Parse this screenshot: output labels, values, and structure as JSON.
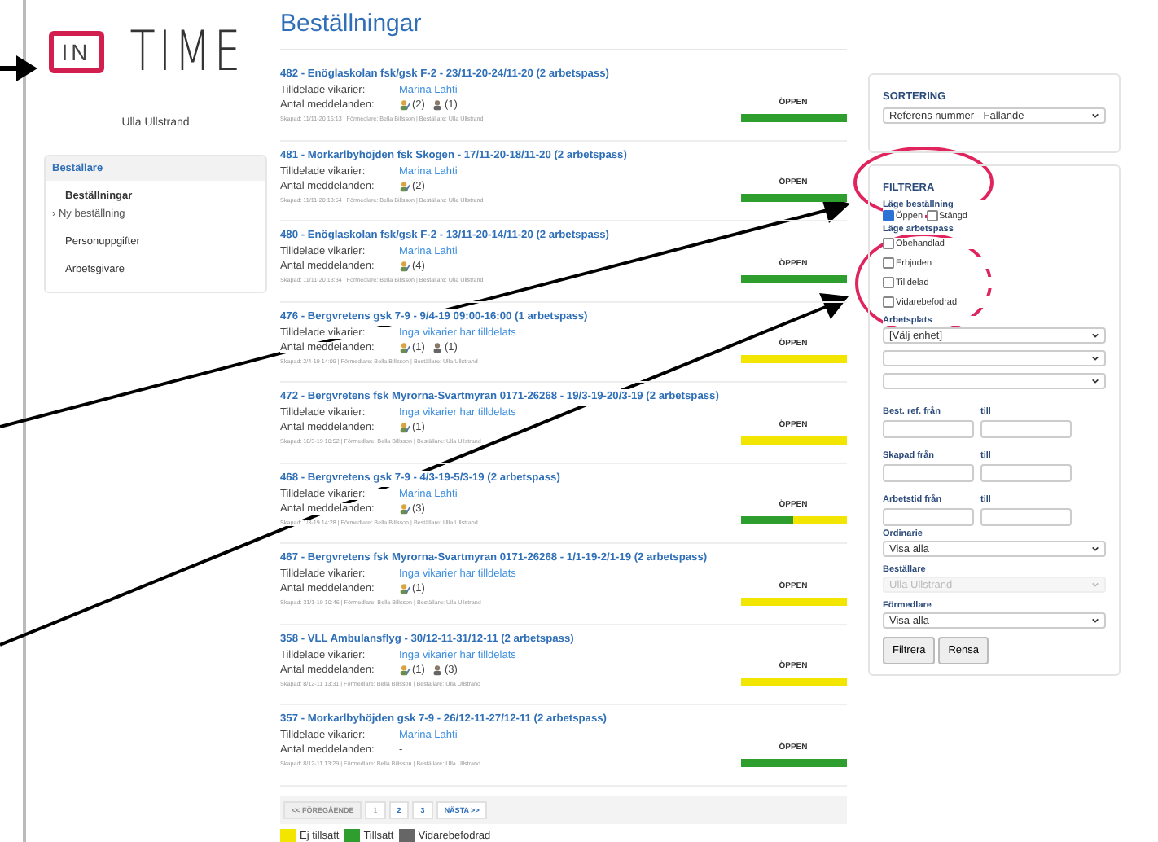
{
  "sidebar": {
    "logo": {
      "boxed": "IN",
      "word": "TIME"
    },
    "user": "Ulla Ullstrand",
    "menu_header": "Beställare",
    "items": [
      {
        "label": "Beställningar",
        "kind": "main",
        "selected": true
      },
      {
        "label": "› Ny beställning",
        "kind": "sub",
        "selected": false
      },
      {
        "label": "Personuppgifter",
        "kind": "main",
        "selected": false
      },
      {
        "label": "Arbetsgivare",
        "kind": "main",
        "selected": false
      }
    ]
  },
  "main": {
    "title": "Beställningar",
    "orders": [
      {
        "title": "482 - Enöglaskolan fsk/gsk F-2 - 23/11-20-24/11-20 (2 arbetspass)",
        "assigned_label": "Tilldelade vikarier:",
        "assigned": "Marina Lahti",
        "messages_label": "Antal meddelanden:",
        "messages": [
          {
            "kind": "message",
            "count": "(2)"
          },
          {
            "kind": "person",
            "count": "(1)"
          }
        ],
        "meta": "Skapad: 11/11-20 16:13 | Förmedlare: Bella Billsson | Beställare: Ulla Ullstrand",
        "status": "ÖPPEN",
        "level": 1
      },
      {
        "title": "481 - Morkarlbyhöjden fsk Skogen - 17/11-20-18/11-20 (2 arbetspass)",
        "assigned_label": "Tilldelade vikarier:",
        "assigned": "Marina Lahti",
        "messages_label": "Antal meddelanden:",
        "messages": [
          {
            "kind": "message",
            "count": "(2)"
          }
        ],
        "meta": "Skapad: 11/11-20 13:54 | Förmedlare: Bella Billsson | Beställare: Ulla Ullstrand",
        "status": "ÖPPEN",
        "level": 1
      },
      {
        "title": "480 - Enöglaskolan fsk/gsk F-2 - 13/11-20-14/11-20 (2 arbetspass)",
        "assigned_label": "Tilldelade vikarier:",
        "assigned": "Marina Lahti",
        "messages_label": "Antal meddelanden:",
        "messages": [
          {
            "kind": "message",
            "count": "(4)"
          }
        ],
        "meta": "Skapad: 11/11-20 13:34 | Förmedlare: Bella Billsson | Beställare: Ulla Ullstrand",
        "status": "ÖPPEN",
        "level": 1
      },
      {
        "title": "476 - Bergvretens gsk 7-9 - 9/4-19 09:00-16:00 (1 arbetspass)",
        "assigned_label": "Tilldelade vikarier:",
        "assigned": "Inga vikarier har tilldelats",
        "messages_label": "Antal meddelanden:",
        "messages": [
          {
            "kind": "message",
            "count": "(1)"
          },
          {
            "kind": "person",
            "count": "(1)"
          }
        ],
        "meta": "Skapad: 2/4-19 14:09 | Förmedlare: Bella Billsson | Beställare: Ulla Ullstrand",
        "status": "ÖPPEN",
        "level": 0
      },
      {
        "title": "472 - Bergvretens fsk Myrorna-Svartmyran 0171-26268 - 19/3-19-20/3-19 (2 arbetspass)",
        "assigned_label": "Tilldelade vikarier:",
        "assigned": "Inga vikarier har tilldelats",
        "messages_label": "Antal meddelanden:",
        "messages": [
          {
            "kind": "message",
            "count": "(1)"
          }
        ],
        "meta": "Skapad: 18/3-19 10:52 | Förmedlare: Bella Billsson | Beställare: Ulla Ullstrand",
        "status": "ÖPPEN",
        "level": 0
      },
      {
        "title": "468 - Bergvretens gsk 7-9 - 4/3-19-5/3-19 (2 arbetspass)",
        "assigned_label": "Tilldelade vikarier:",
        "assigned": "Marina Lahti",
        "messages_label": "Antal meddelanden:",
        "messages": [
          {
            "kind": "message",
            "count": "(3)"
          }
        ],
        "meta": "Skapad: 1/3-19 14:28 | Förmedlare: Bella Billsson | Beställare: Ulla Ullstrand",
        "status": "ÖPPEN",
        "level": 0.5
      },
      {
        "title": "467 - Bergvretens fsk Myrorna-Svartmyran 0171-26268 - 1/1-19-2/1-19 (2 arbetspass)",
        "assigned_label": "Tilldelade vikarier:",
        "assigned": "Inga vikarier har tilldelats",
        "messages_label": "Antal meddelanden:",
        "messages": [
          {
            "kind": "message",
            "count": "(1)"
          }
        ],
        "meta": "Skapad: 31/1-19 10:46 | Förmedlare: Bella Billsson | Beställare: Ulla Ullstrand",
        "status": "ÖPPEN",
        "level": 0
      },
      {
        "title": "358 - VLL Ambulansflyg - 30/12-11-31/12-11 (2 arbetspass)",
        "assigned_label": "Tilldelade vikarier:",
        "assigned": "Inga vikarier har tilldelats",
        "messages_label": "Antal meddelanden:",
        "messages": [
          {
            "kind": "message",
            "count": "(1)"
          },
          {
            "kind": "person",
            "count": "(3)"
          }
        ],
        "meta": "Skapad: 8/12-11 13:31 | Förmedlare: Bella Billsson | Beställare: Ulla Ullstrand",
        "status": "ÖPPEN",
        "level": 0
      },
      {
        "title": "357 - Morkarlbyhöjden gsk 7-9 - 26/12-11-27/12-11 (2 arbetspass)",
        "assigned_label": "Tilldelade vikarier:",
        "assigned": "Marina Lahti",
        "messages_label": "Antal meddelanden:",
        "messages_empty": "-",
        "meta": "Skapad: 8/12-11 13:29 | Förmedlare: Bella Billsson | Beställare: Ulla Ullstrand",
        "status": "ÖPPEN",
        "level": 1
      }
    ],
    "pagination": [
      {
        "label": "<< FÖREGÅENDE",
        "disabled": true,
        "selected": false
      },
      {
        "label": "1",
        "disabled": false,
        "selected": true
      },
      {
        "label": "2",
        "disabled": false,
        "selected": false
      },
      {
        "label": "3",
        "disabled": false,
        "selected": false
      },
      {
        "label": "NÄSTA >>",
        "disabled": false,
        "selected": false
      }
    ],
    "legend": [
      {
        "label": "Ej tillsatt",
        "color": "#f2e600"
      },
      {
        "label": "Tillsatt",
        "color": "#2e9e2e"
      },
      {
        "label": "Vidarebefodrad",
        "color": "#666666"
      }
    ]
  },
  "sorting": {
    "title": "SORTERING",
    "value": "Referens nummer - Fallande"
  },
  "filter": {
    "title": "FILTRERA",
    "order_state_label": "Läge beställning",
    "order_states": [
      {
        "label": "Öppen",
        "checked": true
      },
      {
        "label": "Stängd",
        "checked": false
      }
    ],
    "shift_state_label": "Läge arbetspass",
    "shift_states": [
      {
        "label": "Obehandlad",
        "checked": false
      },
      {
        "label": "Erbjuden",
        "checked": false
      },
      {
        "label": "Tilldelad",
        "checked": false
      },
      {
        "label": "Vidarebefodrad",
        "checked": false
      }
    ],
    "workplace_label": "Arbetsplats",
    "workplace_selects": [
      {
        "kind": "select",
        "value": "[Välj enhet]"
      },
      {
        "kind": "select"
      },
      {
        "kind": "select"
      }
    ],
    "ranges": [
      {
        "label": "Best. ref. från",
        "to_label": "till"
      },
      {
        "label": "Skapad från",
        "to_label": "till"
      },
      {
        "label": "Arbetstid från",
        "to_label": "till"
      }
    ],
    "selects": [
      {
        "label": "Ordinarie",
        "value": "Visa alla",
        "disabled": false
      },
      {
        "label": "Beställare",
        "value": "Ulla Ullstrand",
        "disabled": true
      },
      {
        "label": "Förmedlare",
        "value": "Visa alla",
        "disabled": false
      }
    ],
    "buttons": [
      "Filtrera",
      "Rensa"
    ]
  }
}
